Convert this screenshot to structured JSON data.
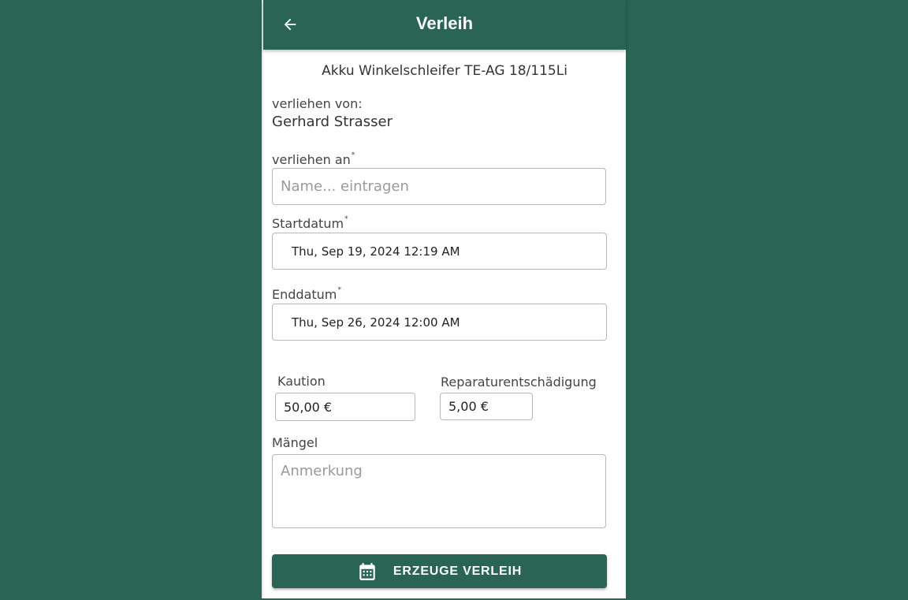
{
  "header": {
    "title": "Verleih",
    "back_icon": "arrow-left-icon"
  },
  "item": {
    "name": "Akku Winkelschleifer  TE-AG 18/115Li"
  },
  "lender": {
    "label": "verliehen von:",
    "name": "Gerhard Strasser"
  },
  "borrower": {
    "label": "verliehen an",
    "required_mark": "*",
    "placeholder": "Name... eintragen",
    "value": ""
  },
  "start_date": {
    "label": "Startdatum",
    "required_mark": "*",
    "value": "Thu, Sep 19, 2024 12:19 AM"
  },
  "end_date": {
    "label": "Enddatum",
    "required_mark": "*",
    "value": "Thu, Sep 26, 2024 12:00 AM"
  },
  "deposit": {
    "label": "Kaution",
    "value": "50,00 €"
  },
  "repair_fee": {
    "label": "Reparaturentschädigung",
    "value": "5,00 €"
  },
  "defects": {
    "label": "Mängel",
    "placeholder": "Anmerkung",
    "value": ""
  },
  "create_button": {
    "label": "ERZEUGE VERLEIH",
    "icon": "calendar-icon"
  },
  "colors": {
    "primary": "#2a6454",
    "surface": "#ffffff"
  }
}
